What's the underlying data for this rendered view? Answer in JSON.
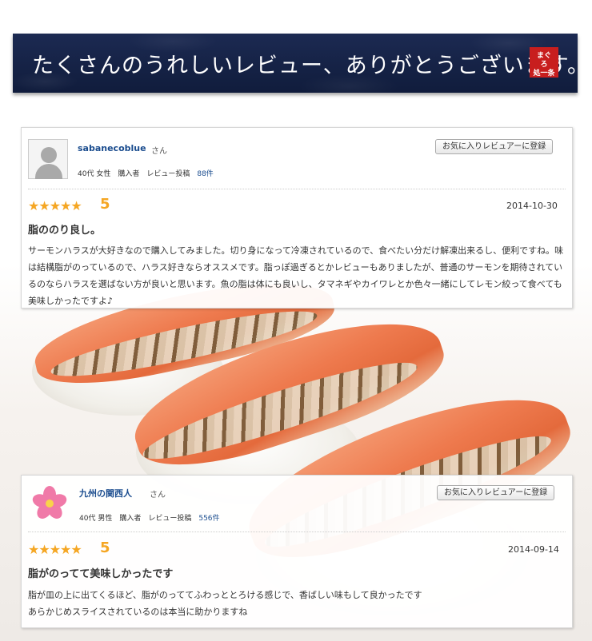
{
  "banner": {
    "title": "たくさんのうれしいレビュー、ありがとうございます。",
    "logo_text": "まぐろ処一条"
  },
  "reviews": [
    {
      "name": "sabanecoblue",
      "honorific": "さん",
      "meta": "40代 女性　購入者　レビュー投稿",
      "post_count": "88件",
      "favorite_button": "お気に入りレビュアーに登録",
      "stars": "★★★★★",
      "rating": "5",
      "date": "2014-10-30",
      "title": "脂ののり良し。",
      "body": "サーモンハラスが大好きなので購入してみました。切り身になって冷凍されているので、食べたい分だけ解凍出来るし、便利ですね。味は結構脂がのっているので、ハラス好きならオススメです。脂っぽ過ぎるとかレビューもありましたが、普通のサーモンを期待されているのならハラスを選ばない方が良いと思います。魚の脂は体にも良いし、タマネギやカイワレとか色々一緒にしてレモン絞って食べても美味しかったですよ♪"
    },
    {
      "name": "九州の関西人",
      "honorific": "さん",
      "meta": "40代 男性　購入者　レビュー投稿",
      "post_count": "556件",
      "favorite_button": "お気に入りレビュアーに登録",
      "stars": "★★★★★",
      "rating": "5",
      "date": "2014-09-14",
      "title": "脂がのってて美味しかったです",
      "body": "脂が皿の上に出てくるほど、脂がのっててふわっととろける感じで、香ばしい味もして良かったです\nあらかじめスライスされているのは本当に助かりますね"
    }
  ],
  "colors": {
    "banner_bg": "#1c2a52",
    "name_link": "#1a4c8e",
    "star": "#f5a623"
  }
}
